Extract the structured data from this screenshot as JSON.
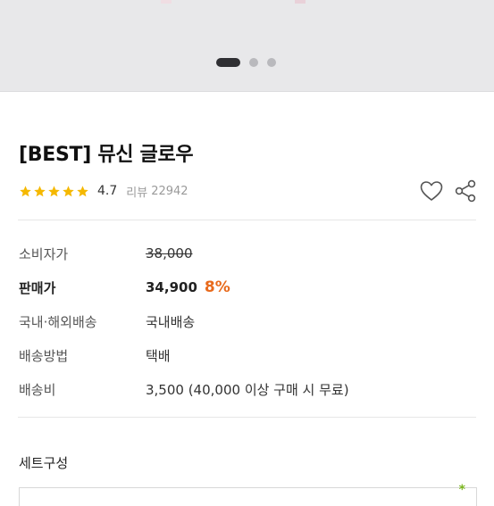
{
  "product": {
    "title": "[BEST] 뮤신 글로우",
    "rating": 4.7,
    "rating_text": "4.7",
    "stars_filled": 5,
    "review_label": "리뷰",
    "review_count": "22942"
  },
  "gallery": {
    "current_slide": 1,
    "slide_count": 3
  },
  "info": {
    "rows": [
      {
        "label": "소비자가",
        "value": "38,000"
      },
      {
        "label": "판매가",
        "value": "34,900",
        "discount": "8%"
      },
      {
        "label": "국내·해외배송",
        "value": "국내배송"
      },
      {
        "label": "배송방법",
        "value": "택배"
      },
      {
        "label": "배송비",
        "value": "3,500 (40,000 이상 구매 시 무료)"
      }
    ]
  },
  "set": {
    "title": "세트구성",
    "required_mark": "*"
  },
  "colors": {
    "star": "#f5b800",
    "discount": "#e86a1c",
    "required": "#7ab41e",
    "dot_active": "#2f2f33",
    "dot_inactive": "#b9b9bd"
  },
  "icons": {
    "wishlist": "heart-icon",
    "share": "share-icon"
  }
}
